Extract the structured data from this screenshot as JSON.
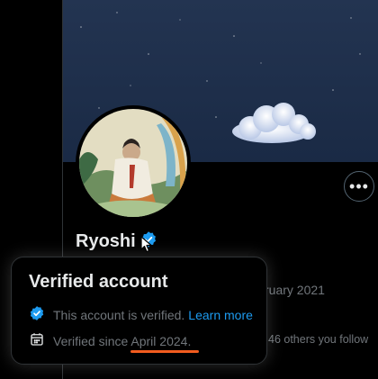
{
  "profile": {
    "display_name": "Ryoshi",
    "joined_partial": "ruary 2021",
    "followers_partial": "46 others you follow"
  },
  "more_button_glyph": "•••",
  "popup": {
    "title": "Verified account",
    "verified_text": "This account is verified.",
    "learn_more": "Learn more",
    "since_prefix": "Verified since ",
    "since_date": "April 2024",
    "since_suffix": "."
  },
  "colors": {
    "background": "#000000",
    "verified_blue": "#1d9bf0",
    "underline_orange": "#f25c1f",
    "muted_text": "#71767b"
  },
  "icons": {
    "verified": "verified-badge-icon",
    "calendar": "calendar-icon",
    "more": "more-icon",
    "cursor": "cursor-icon"
  }
}
